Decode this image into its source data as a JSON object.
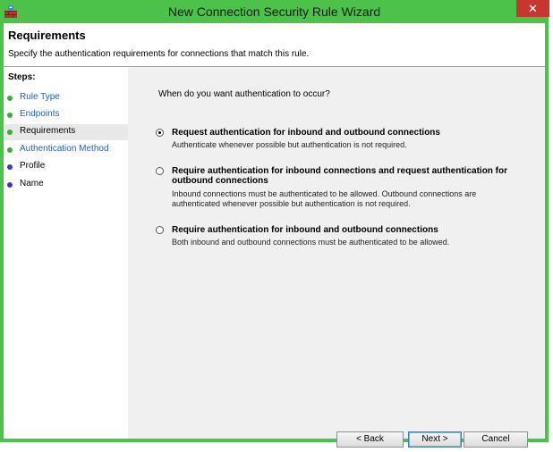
{
  "window": {
    "title": "New Connection Security Rule Wizard",
    "close_glyph": "✕"
  },
  "header": {
    "title": "Requirements",
    "subtitle": "Specify the authentication requirements for connections that match this rule."
  },
  "steps": {
    "label": "Steps:",
    "items": [
      {
        "label": "Rule Type",
        "state": "done"
      },
      {
        "label": "Endpoints",
        "state": "done"
      },
      {
        "label": "Requirements",
        "state": "current"
      },
      {
        "label": "Authentication Method",
        "state": "done"
      },
      {
        "label": "Profile",
        "state": "todo"
      },
      {
        "label": "Name",
        "state": "todo"
      }
    ]
  },
  "content": {
    "question": "When do you want authentication to occur?",
    "options": [
      {
        "title": "Request authentication for inbound and outbound connections",
        "description": "Authenticate whenever possible but authentication is not required.",
        "selected": true
      },
      {
        "title": "Require authentication for inbound connections and request authentication for outbound connections",
        "description": "Inbound connections must be authenticated to be allowed. Outbound connections are authenticated whenever possible but authentication is not required.",
        "selected": false
      },
      {
        "title": "Require authentication for inbound and outbound connections",
        "description": "Both inbound and outbound connections must be authenticated to be allowed.",
        "selected": false
      }
    ]
  },
  "buttons": {
    "back": "< Back",
    "next": "Next >",
    "cancel": "Cancel"
  },
  "colors": {
    "frame": "#4bc24a",
    "close": "#c7372f",
    "link": "#1f5fbf",
    "step_done": "#34b034",
    "step_todo": "#3d3ab0"
  },
  "icons": {
    "app": "firewall-app-icon",
    "close": "close-icon"
  }
}
